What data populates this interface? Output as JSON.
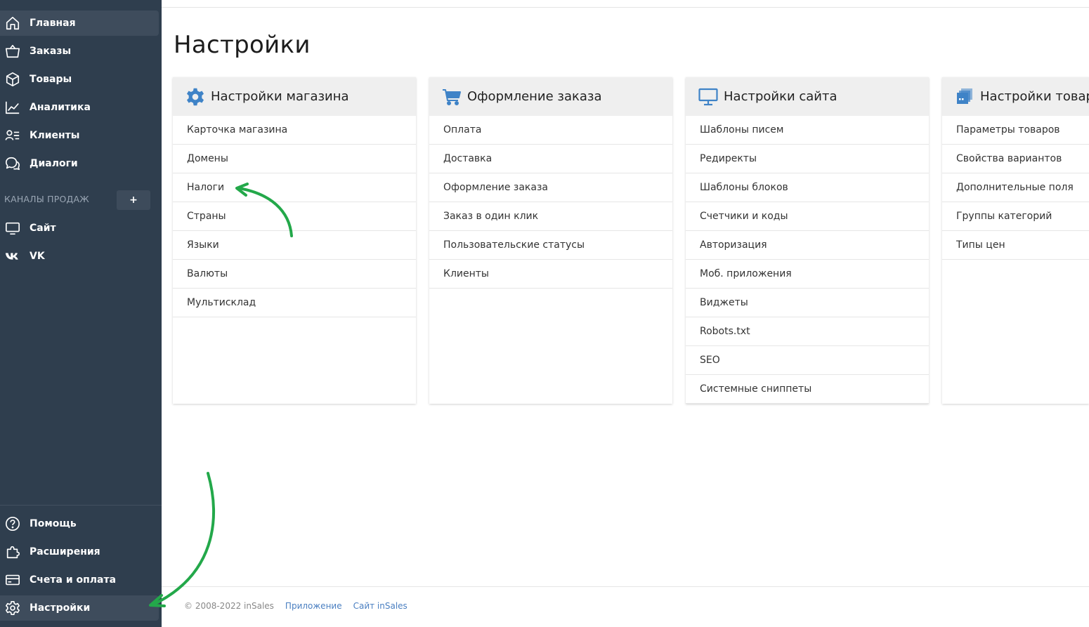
{
  "sidebar": {
    "nav_items": [
      {
        "label": "Главная",
        "icon": "home-icon"
      },
      {
        "label": "Заказы",
        "icon": "basket-icon"
      },
      {
        "label": "Товары",
        "icon": "box-icon"
      },
      {
        "label": "Аналитика",
        "icon": "chart-line-icon"
      },
      {
        "label": "Клиенты",
        "icon": "clients-icon"
      },
      {
        "label": "Диалоги",
        "icon": "chat-icon"
      }
    ],
    "channels_label": "КАНАЛЫ ПРОДАЖ",
    "add_channel_label": "+",
    "channel_items": [
      {
        "label": "Сайт",
        "icon": "monitor-icon"
      },
      {
        "label": "VK",
        "icon": "vk-icon"
      }
    ],
    "bottom_items": [
      {
        "label": "Помощь",
        "icon": "help-icon"
      },
      {
        "label": "Расширения",
        "icon": "puzzle-icon"
      },
      {
        "label": "Счета и оплата",
        "icon": "card-icon"
      },
      {
        "label": "Настройки",
        "icon": "gear-icon"
      }
    ],
    "active_item": "Главная"
  },
  "page": {
    "title": "Настройки"
  },
  "cards": [
    {
      "title": "Настройки магазина",
      "icon": "gear-icon",
      "items": [
        "Карточка магазина",
        "Домены",
        "Налоги",
        "Страны",
        "Языки",
        "Валюты",
        "Мультисклад"
      ]
    },
    {
      "title": "Оформление заказа",
      "icon": "cart-icon",
      "items": [
        "Оплата",
        "Доставка",
        "Оформление заказа",
        "Заказ в один клик",
        "Пользовательские статусы",
        "Клиенты"
      ]
    },
    {
      "title": "Настройки сайта",
      "icon": "monitor-icon",
      "items": [
        "Шаблоны писем",
        "Редиректы",
        "Шаблоны блоков",
        "Счетчики и коды",
        "Авторизация",
        "Моб. приложения",
        "Виджеты",
        "Robots.txt",
        "SEO",
        "Системные сниппеты"
      ]
    },
    {
      "title": "Настройки товаров",
      "icon": "boxes-icon",
      "items": [
        "Параметры товаров",
        "Свойства вариантов",
        "Дополнительные поля",
        "Группы категорий",
        "Типы цен"
      ]
    }
  ],
  "footer": {
    "copyright": "© 2008-2022 inSales",
    "links": [
      "Приложение",
      "Сайт inSales"
    ]
  },
  "colors": {
    "sidebar_bg": "#2f3e4e",
    "sidebar_active": "#3e4c5c",
    "accent_blue": "#3f83c7",
    "annotation_green": "#23a84a",
    "link": "#4a7fc1"
  }
}
